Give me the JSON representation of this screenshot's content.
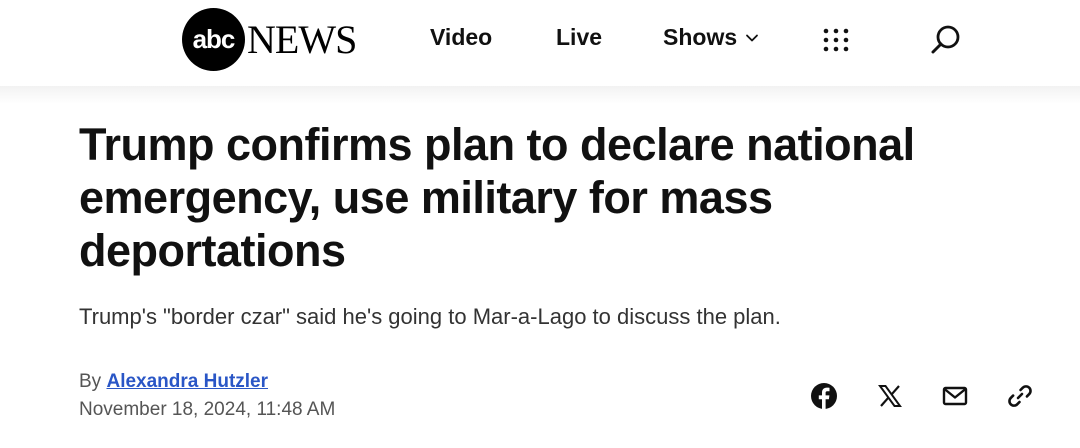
{
  "header": {
    "logo": {
      "abc": "abc",
      "news": "NEWS"
    },
    "nav": {
      "video": "Video",
      "live": "Live",
      "shows": "Shows"
    },
    "icons": [
      "chevron-down-icon",
      "grid-menu-icon",
      "search-icon"
    ]
  },
  "article": {
    "headline": "Trump confirms plan to declare national emergency, use military for mass deportations",
    "dek": "Trump's \"border czar\" said he's going to Mar-a-Lago to discuss the plan.",
    "byline_prefix": "By",
    "author": "Alexandra Hutzler",
    "timestamp": "November 18, 2024, 11:48 AM"
  },
  "share": {
    "icons": [
      "facebook-icon",
      "x-icon",
      "mail-icon",
      "link-icon"
    ]
  },
  "colors": {
    "author_link": "#2a56c6",
    "text": "#111111",
    "meta": "#555555"
  }
}
